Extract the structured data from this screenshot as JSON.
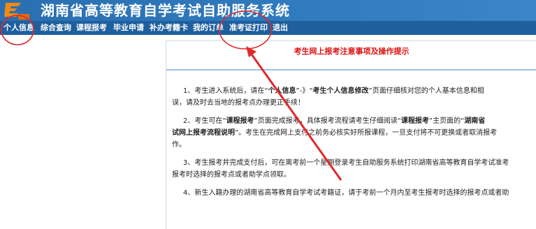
{
  "header": {
    "title": "湖南省高等教育自学考试自助服务系统"
  },
  "nav": {
    "items": [
      {
        "label": "个人信息"
      },
      {
        "label": "综合查询"
      },
      {
        "label": "课程报考"
      },
      {
        "label": "毕业申请"
      },
      {
        "label": "补办考籍卡"
      },
      {
        "label": "我的订单"
      },
      {
        "label": "准考证打印"
      },
      {
        "label": "退出"
      }
    ]
  },
  "notice": {
    "title": "考生网上报考注意事项及操作提示",
    "p1": {
      "l1_a": "1、考生进入系统后，请在“",
      "l1_b": "个人信息",
      "l1_c": "”-》“",
      "l1_d": "考生个人信息修改",
      "l1_e": "”页面仔细核对您的个人基本信息和相",
      "l2": "误，请及时去当地的报考点办理更正手续！"
    },
    "p2": {
      "l1_a": "2、考生可在“",
      "l1_b": "课程报考",
      "l1_c": "”页面完成报考，具体报考流程请考生仔细阅读“",
      "l1_d": "课程报考",
      "l1_e": "”主页面的“",
      "l1_f": "湖南省",
      "l2_a": "试网上报考流程说明",
      "l2_b": "”。考生在完成网上支付之前务必核实好所报课程，一旦支付将不可更换或者取消报考",
      "l3": "作。"
    },
    "p3": {
      "l1": "3、考生报考并完成支付后，可在离考前一个星期登录考生自助服务系统打印湖南省高等教育自学考试准考",
      "l2": "报考时选择的报考点或者助学点领取。"
    },
    "p4": {
      "l1": "4、新生入籍办理的湖南省高等教育自学考试考籍证，请于考前一个月内至考生报考时选择的报考点或者助"
    }
  },
  "colors": {
    "header_bg": "#2f79bd",
    "nav_bg": "#1e5f9e",
    "title_red": "#e01010",
    "annotation_red": "#e0282a"
  }
}
